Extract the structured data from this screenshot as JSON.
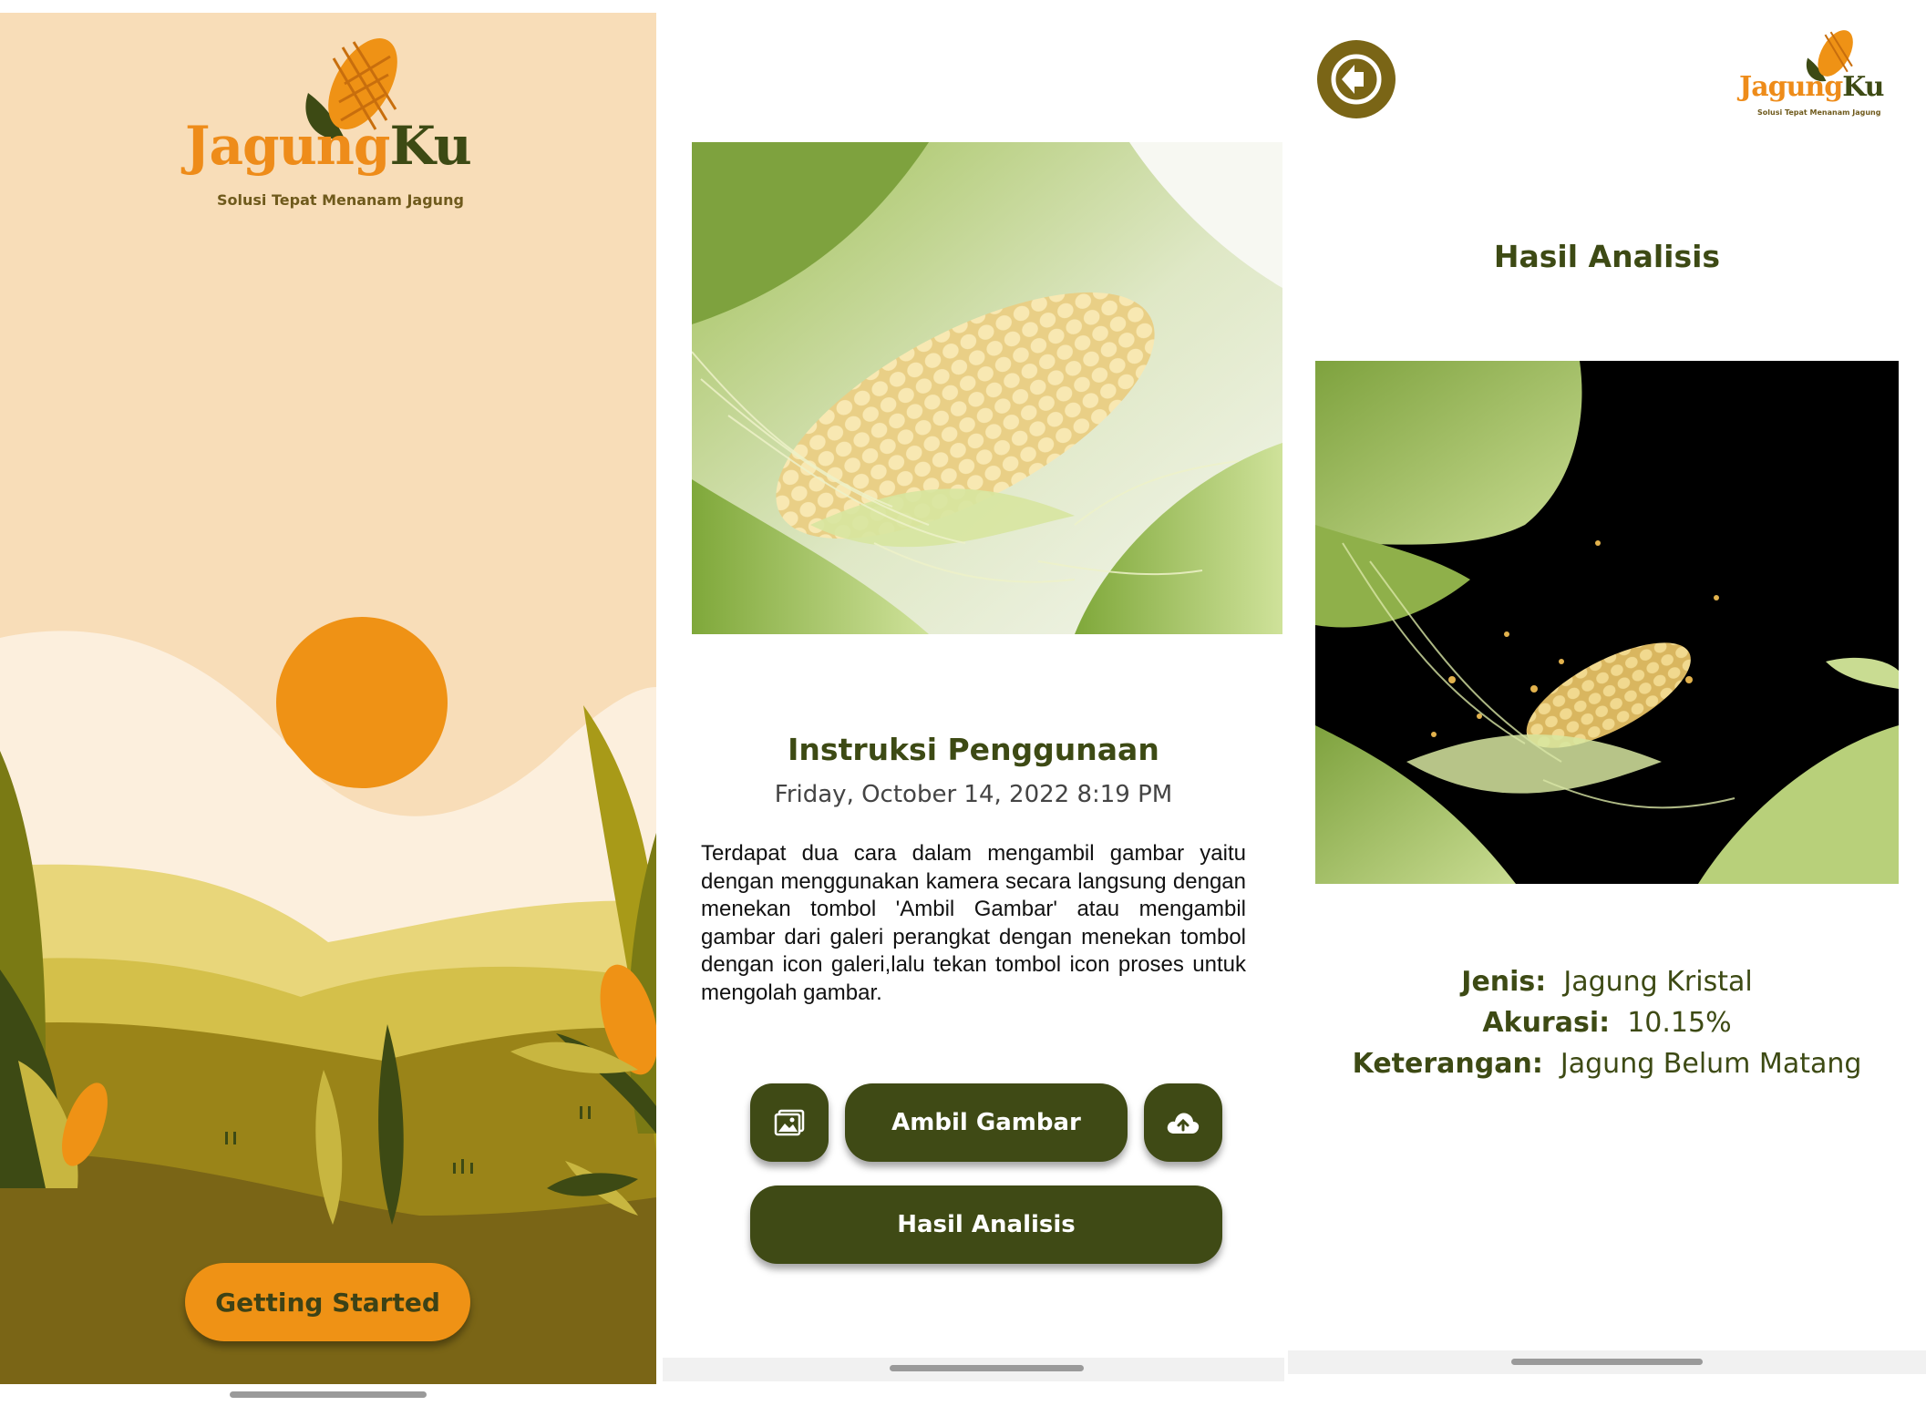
{
  "splash": {
    "logo_part1": "Jagung",
    "logo_part2": "Ku",
    "tagline": "Solusi Tepat Menanam Jagung",
    "cta_label": "Getting Started"
  },
  "instructions": {
    "title": "Instruksi Penggunaan",
    "datetime": "Friday, October 14, 2022 8:19 PM",
    "body": "Terdapat dua cara dalam mengambil gambar yaitu dengan menggunakan kamera secara langsung dengan menekan tombol 'Ambil Gambar' atau mengambil gambar dari galeri perangkat dengan menekan tombol dengan icon galeri,lalu tekan tombol icon proses untuk mengolah gambar.",
    "take_photo_label": "Ambil Gambar",
    "analysis_label": "Hasil Analisis",
    "gallery_icon": "gallery-icon",
    "upload_icon": "cloud-upload-icon"
  },
  "result": {
    "title": "Hasil Analisis",
    "logo_part1": "Jagung",
    "logo_part2": "Ku",
    "tagline": "Solusi Tepat Menanam Jagung",
    "back_icon": "arrow-left-icon",
    "type_label": "Jenis:",
    "type_value": "Jagung Kristal",
    "accuracy_label": "Akurasi:",
    "accuracy_value": "10.15%",
    "note_label": "Keterangan:",
    "note_value": "Jagung Belum Matang"
  },
  "colors": {
    "brand_orange": "#ef9215",
    "brand_dark_green": "#3f4a15",
    "olive": "#7a6516",
    "splash_bg": "#f8ddb8"
  }
}
